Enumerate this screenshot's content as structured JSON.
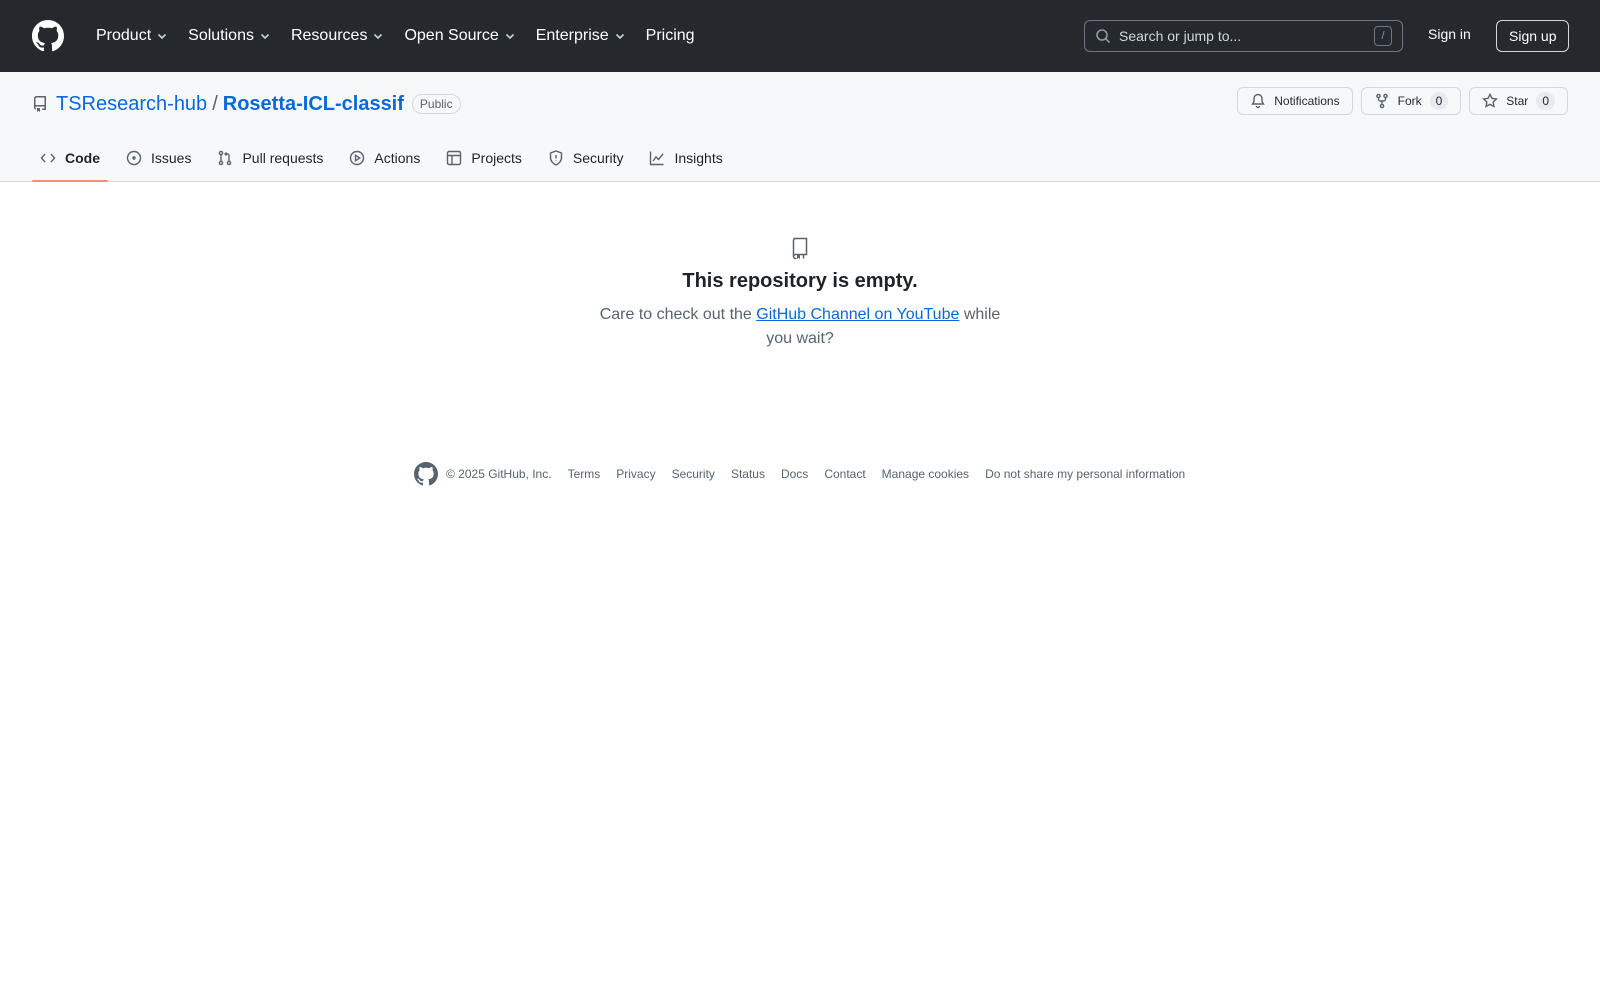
{
  "header": {
    "logo_icon": "github-mark-icon",
    "nav": [
      {
        "label": "Product",
        "has_dropdown": true
      },
      {
        "label": "Solutions",
        "has_dropdown": true
      },
      {
        "label": "Resources",
        "has_dropdown": true
      },
      {
        "label": "Open Source",
        "has_dropdown": true
      },
      {
        "label": "Enterprise",
        "has_dropdown": true
      },
      {
        "label": "Pricing",
        "has_dropdown": false
      }
    ],
    "search": {
      "placeholder": "Search or jump to...",
      "shortcut": "/"
    },
    "sign_in": "Sign in",
    "sign_up": "Sign up"
  },
  "repo": {
    "owner": "TSResearch-hub",
    "separator": "/",
    "name": "Rosetta-ICL-classif",
    "visibility": "Public",
    "actions": {
      "notifications": "Notifications",
      "fork": {
        "label": "Fork",
        "count": "0"
      },
      "star": {
        "label": "Star",
        "count": "0"
      }
    },
    "tabs": [
      {
        "label": "Code",
        "icon": "code-icon",
        "selected": true
      },
      {
        "label": "Issues",
        "icon": "issue-icon",
        "selected": false
      },
      {
        "label": "Pull requests",
        "icon": "pull-request-icon",
        "selected": false
      },
      {
        "label": "Actions",
        "icon": "play-icon",
        "selected": false
      },
      {
        "label": "Projects",
        "icon": "table-icon",
        "selected": false
      },
      {
        "label": "Security",
        "icon": "shield-icon",
        "selected": false
      },
      {
        "label": "Insights",
        "icon": "graph-icon",
        "selected": false
      }
    ]
  },
  "empty_state": {
    "icon": "repo-icon",
    "title": "This repository is empty.",
    "text_before": "Care to check out the ",
    "link_text": "GitHub Channel on YouTube",
    "text_after": " while you wait?"
  },
  "footer": {
    "copyright": "© 2025 GitHub, Inc.",
    "links": [
      "Terms",
      "Privacy",
      "Security",
      "Status",
      "Docs",
      "Contact",
      "Manage cookies",
      "Do not share my personal information"
    ]
  },
  "colors": {
    "header_bg": "#25292e",
    "link": "#0969da",
    "tab_underline": "#fd8c73",
    "repo_header_bg": "#f6f8fa"
  }
}
